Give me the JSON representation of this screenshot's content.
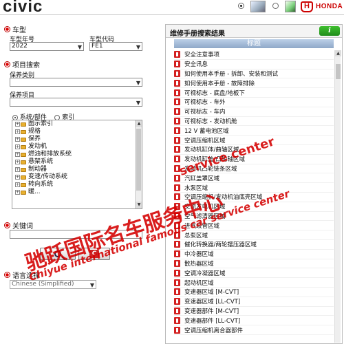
{
  "header": {
    "logo_text": "civic",
    "brand_text": "HONDA",
    "view_mode_1_selected": true,
    "view_mode_2_selected": false
  },
  "vehicle": {
    "section_title": "车型",
    "year_label": "车型年号",
    "year_value": "2022",
    "code_label": "车型代码",
    "code_value": "FE1"
  },
  "item_search": {
    "section_title": "项目搜索",
    "maint_type_label": "保养类别",
    "maint_type_value": "",
    "maint_item_label": "保养项目",
    "maint_item_value": "",
    "radio_system_label": "系统/部件",
    "radio_index_label": "索引",
    "radio_system_selected": true
  },
  "tree_items": [
    "图示索引",
    "规格",
    "保养",
    "发动机",
    "燃油和排放系统",
    "悬架系统",
    "制动器",
    "变速/传动系统",
    "转向系统",
    "暖..."
  ],
  "keyword": {
    "section_title": "关键词",
    "value": ""
  },
  "language": {
    "section_title": "语言选择",
    "value": "Chinese (Simplified)"
  },
  "results": {
    "panel_title": "维修手册搜索结果",
    "info_label": "i",
    "column_header": "标题",
    "rows": [
      "安全注意事项",
      "安全讯息",
      "如何使用本手册 - 拆卸、安装和测试",
      "如何使用本手册 - 故障排除",
      "可视标志 - 底盘/地板下",
      "可视标志 - 车外",
      "可视标志 - 车内",
      "可视标志 - 发动机舱",
      "12 V 蓄电池区域",
      "空调压缩机区域",
      "发动机缸体/曲轴区域",
      "发动机缸盖/凸轮轴区域",
      "发动机凸轮链条区域",
      "汽缸盖罩区域",
      "水泵区域",
      "空调压缩机/发动机油底壳区域",
      "交流发电机区域",
      "空气滤清器区域",
      "进气歧管区域",
      "总泵区域",
      "催化转换器/两轮摆压器区域",
      "中冷器区域",
      "散热器区域",
      "空调冷凝器区域",
      "起动机区域",
      "变速器区域 [M-CVT]",
      "变速器区域 [LL-CVT]",
      "变速器部件 [M-CVT]",
      "变速器部件 [LL-CVT]",
      "空调压缩机离合器部件"
    ]
  },
  "watermark": {
    "line1": "驰跃国际名车服务中心",
    "line2": "Chiyue international famous car service center",
    "line3": "service center"
  }
}
